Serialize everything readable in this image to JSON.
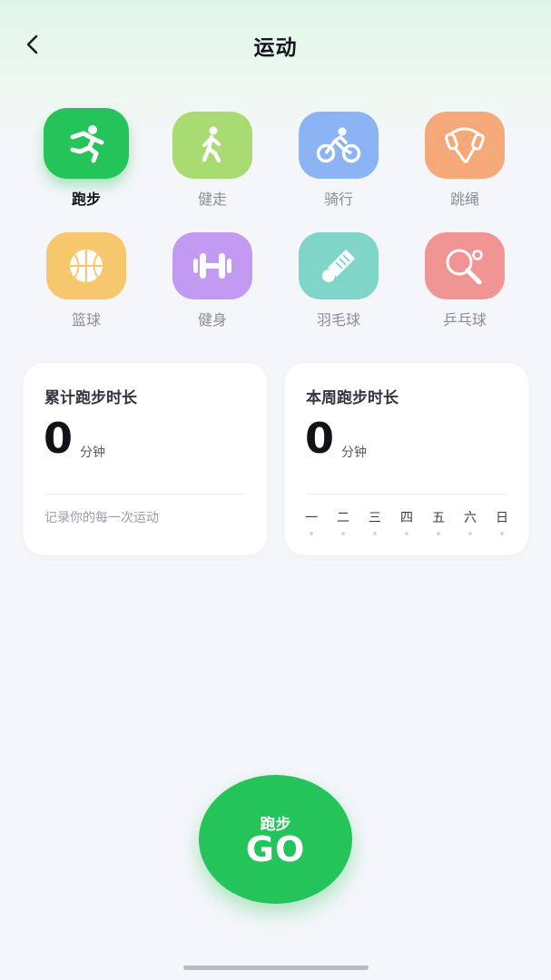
{
  "header": {
    "title": "运动",
    "back_icon": "chevron-left-icon"
  },
  "sports": [
    {
      "id": "running",
      "label": "跑步",
      "icon": "running-icon",
      "color": "#25c45a",
      "selected": true
    },
    {
      "id": "walking",
      "label": "健走",
      "icon": "walking-icon",
      "color": "#a8dc72",
      "selected": false
    },
    {
      "id": "cycling",
      "label": "骑行",
      "icon": "cycling-icon",
      "color": "#8cb4f4",
      "selected": false
    },
    {
      "id": "jump-rope",
      "label": "跳绳",
      "icon": "jump-rope-icon",
      "color": "#f5a978",
      "selected": false
    },
    {
      "id": "basketball",
      "label": "篮球",
      "icon": "basketball-icon",
      "color": "#f6c76c",
      "selected": false
    },
    {
      "id": "fitness",
      "label": "健身",
      "icon": "dumbbell-icon",
      "color": "#c39af2",
      "selected": false
    },
    {
      "id": "badminton",
      "label": "羽毛球",
      "icon": "shuttlecock-icon",
      "color": "#7fd6c8",
      "selected": false
    },
    {
      "id": "table-tennis",
      "label": "乒乓球",
      "icon": "ping-pong-icon",
      "color": "#f19494",
      "selected": false
    }
  ],
  "total_card": {
    "title": "累计跑步时长",
    "value": "0",
    "unit": "分钟",
    "note": "记录你的每一次运动"
  },
  "week_card": {
    "title": "本周跑步时长",
    "value": "0",
    "unit": "分钟",
    "days": [
      "一",
      "二",
      "三",
      "四",
      "五",
      "六",
      "日"
    ]
  },
  "go_button": {
    "sub_label": "跑步",
    "main_label": "GO",
    "color": "#25c45a"
  }
}
